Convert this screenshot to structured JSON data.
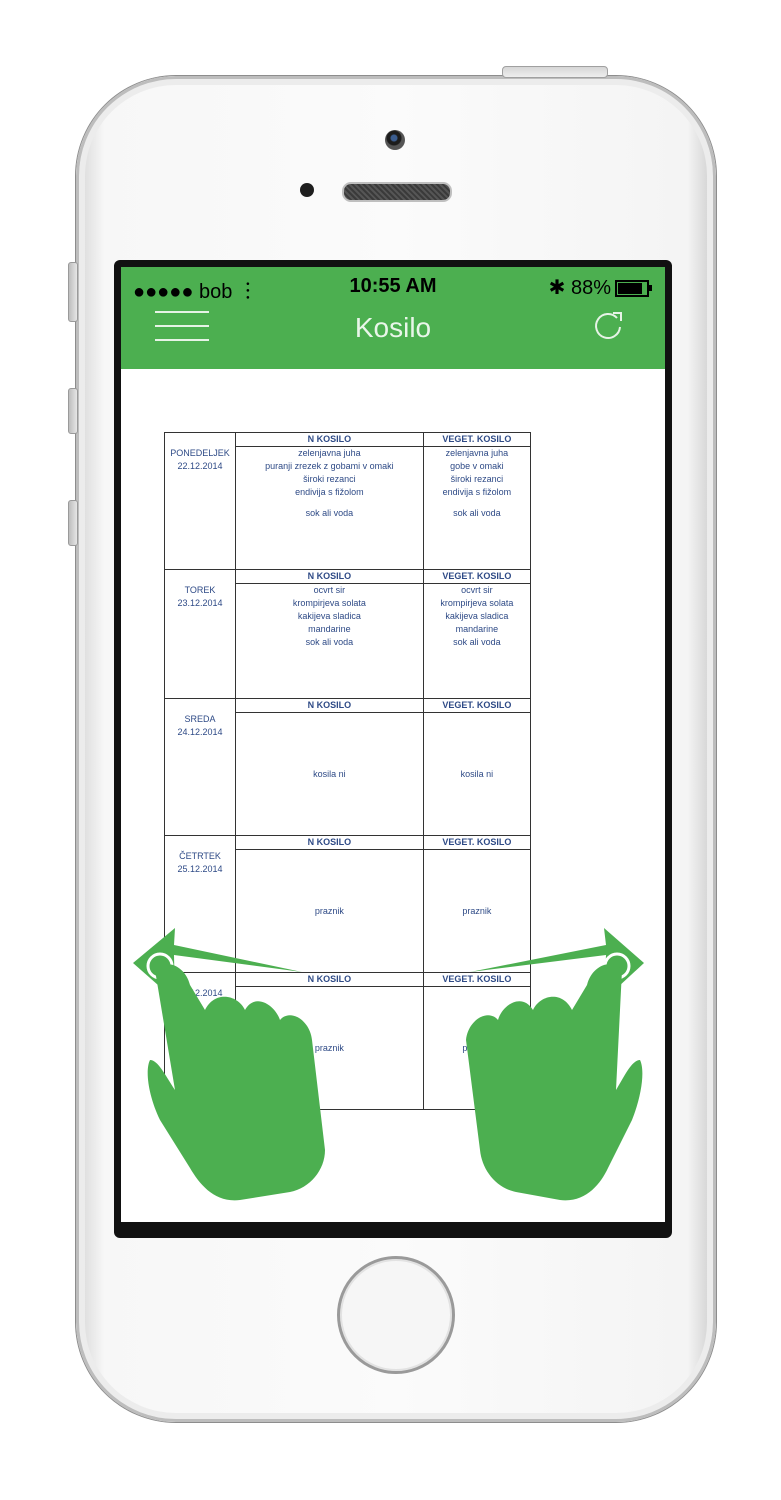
{
  "status_bar": {
    "carrier": "●●●●● bob",
    "time": "10:55 AM",
    "battery": "88%"
  },
  "navbar": {
    "title": "Kosilo",
    "accent_color": "#4caf50"
  },
  "table": {
    "columns": [
      "N KOSILO",
      "VEGET. KOSILO"
    ],
    "days": [
      {
        "day": "PONEDELJEK",
        "date": "22.12.2014",
        "n_kosilo": [
          "zelenjavna juha",
          "puranji zrezek z gobami v omaki",
          "široki rezanci",
          "endivija s fižolom",
          "",
          "sok ali voda"
        ],
        "veget": [
          "zelenjavna juha",
          "gobe v omaki",
          "široki rezanci",
          "endivija s fižolom",
          "",
          "sok ali voda"
        ]
      },
      {
        "day": "TOREK",
        "date": "23.12.2014",
        "n_kosilo": [
          "ocvrt sir",
          "krompirjeva solata",
          "kakijeva sladica",
          "mandarine",
          "sok ali voda"
        ],
        "veget": [
          "ocvrt sir",
          "krompirjeva solata",
          "kakijeva sladica",
          "mandarine",
          "sok ali voda"
        ]
      },
      {
        "day": "SREDA",
        "date": "24.12.2014",
        "n_kosilo": [
          "kosila ni"
        ],
        "veget": [
          "kosila ni"
        ]
      },
      {
        "day": "ČETRTEK",
        "date": "25.12.2014",
        "n_kosilo": [
          "praznik"
        ],
        "veget": [
          "praznik"
        ]
      },
      {
        "day": "",
        "date": "26.12.2014",
        "n_kosilo": [
          "praznik"
        ],
        "veget": [
          "praznik"
        ]
      }
    ]
  },
  "icons": {
    "menu": "hamburger-icon",
    "refresh": "refresh-icon",
    "swipe": "swipe-hand-icon"
  }
}
